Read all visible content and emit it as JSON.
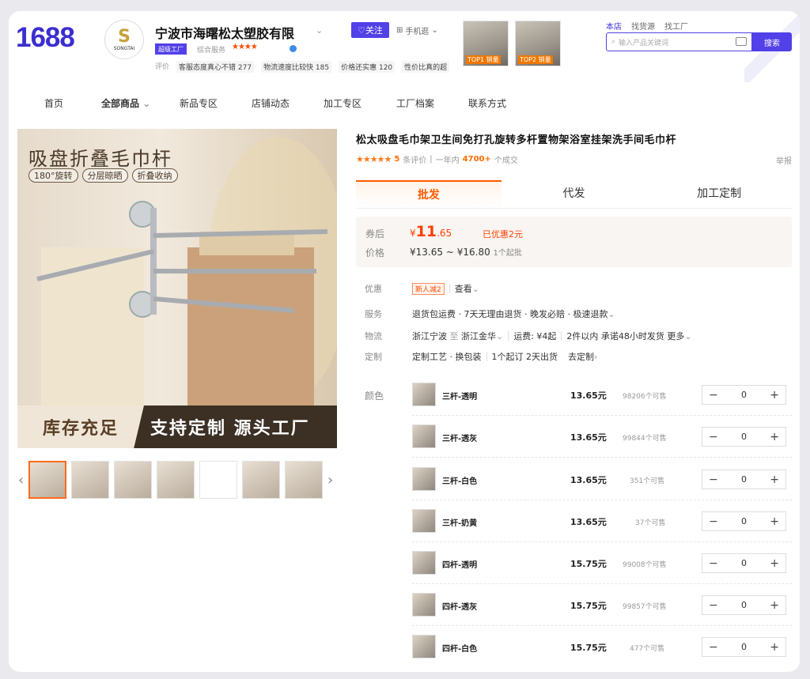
{
  "header": {
    "logo": "1688",
    "avatar_brand": "SONGTAI",
    "avatar_mark": "S",
    "shop_name": "宁波市海曙松太塑胶有限",
    "follow_label": "关注",
    "mobile_label": "手机逛",
    "badge_label": "超级工厂",
    "service_label": "综合服务",
    "service_stars": "★★★★",
    "rating_label": "评价",
    "ratings": [
      "客服态度真心不错 277",
      "物流速度比较快 185",
      "价格还实惠 120",
      "性价比真的超"
    ],
    "thumbs": [
      {
        "rank": "TOP1 销量"
      },
      {
        "rank": "TOP2 销量"
      }
    ],
    "top_links": [
      "本店",
      "找货源",
      "找工厂"
    ],
    "search_placeholder": "输入产品关键词",
    "search_button": "搜索"
  },
  "nav": [
    "首页",
    "全部商品",
    "新品专区",
    "店铺动态",
    "加工专区",
    "工厂档案",
    "联系方式"
  ],
  "gallery": {
    "main_title": "吸盘折叠毛巾杆",
    "pills": [
      "180°旋转",
      "分层晾晒",
      "折叠收纳"
    ],
    "banner_left": "库存充足",
    "banner_right": "支持定制 源头工厂",
    "prev": "‹",
    "next": "›"
  },
  "product": {
    "title": "松太吸盘毛巾架卫生间免打孔旋转多杆置物架浴室挂架洗手间毛巾杆",
    "stars": "★★★★★",
    "review_count": "5",
    "review_label": "条评价",
    "year_label": "一年内",
    "sold": "4700+",
    "sold_label": "个成交",
    "report": "举报"
  },
  "tabs": [
    "批发",
    "代发",
    "加工定制"
  ],
  "price": {
    "coupon_label": "券后",
    "currency": "¥",
    "coupon_int": "11",
    "coupon_dec": ".65",
    "discount": "已优惠2元",
    "price_label": "价格",
    "range_low": "¥13.65",
    "tilde": "~",
    "range_high": "¥16.80",
    "moq": "1个起批"
  },
  "info": {
    "promo_label": "优惠",
    "promo_badge": "新人减2",
    "promo_view": "查看",
    "service_label": "服务",
    "service_text": "退货包运费 · 7天无理由退货 · 晚发必赔 · 极速退款",
    "logistics_label": "物流",
    "logistics_from": "浙江宁波",
    "logistics_to_word": "至",
    "logistics_to": "浙江金华",
    "logistics_fee": "运费: ¥4起",
    "logistics_promise": "2件以内 承诺48小时发货",
    "logistics_more": "更多",
    "custom_label": "定制",
    "custom_text": "定制工艺 · 换包装",
    "custom_moq": "1个起订 2天出货",
    "custom_go": "去定制"
  },
  "variants_label": "颜色",
  "variants": [
    {
      "name": "三杆-透明",
      "price": "13.65元",
      "stock": "98206个可售",
      "qty": "0"
    },
    {
      "name": "三杆-透灰",
      "price": "13.65元",
      "stock": "99844个可售",
      "qty": "0"
    },
    {
      "name": "三杆-白色",
      "price": "13.65元",
      "stock": "351个可售",
      "qty": "0"
    },
    {
      "name": "三杆-奶黄",
      "price": "13.65元",
      "stock": "37个可售",
      "qty": "0"
    },
    {
      "name": "四杆-透明",
      "price": "15.75元",
      "stock": "99008个可售",
      "qty": "0"
    },
    {
      "name": "四杆-透灰",
      "price": "15.75元",
      "stock": "99857个可售",
      "qty": "0"
    },
    {
      "name": "四杆-白色",
      "price": "15.75元",
      "stock": "477个可售",
      "qty": "0"
    }
  ],
  "stepper": {
    "minus": "−",
    "plus": "+"
  },
  "colors": {
    "brand": "#5240e8",
    "accent": "#ff5a00"
  }
}
